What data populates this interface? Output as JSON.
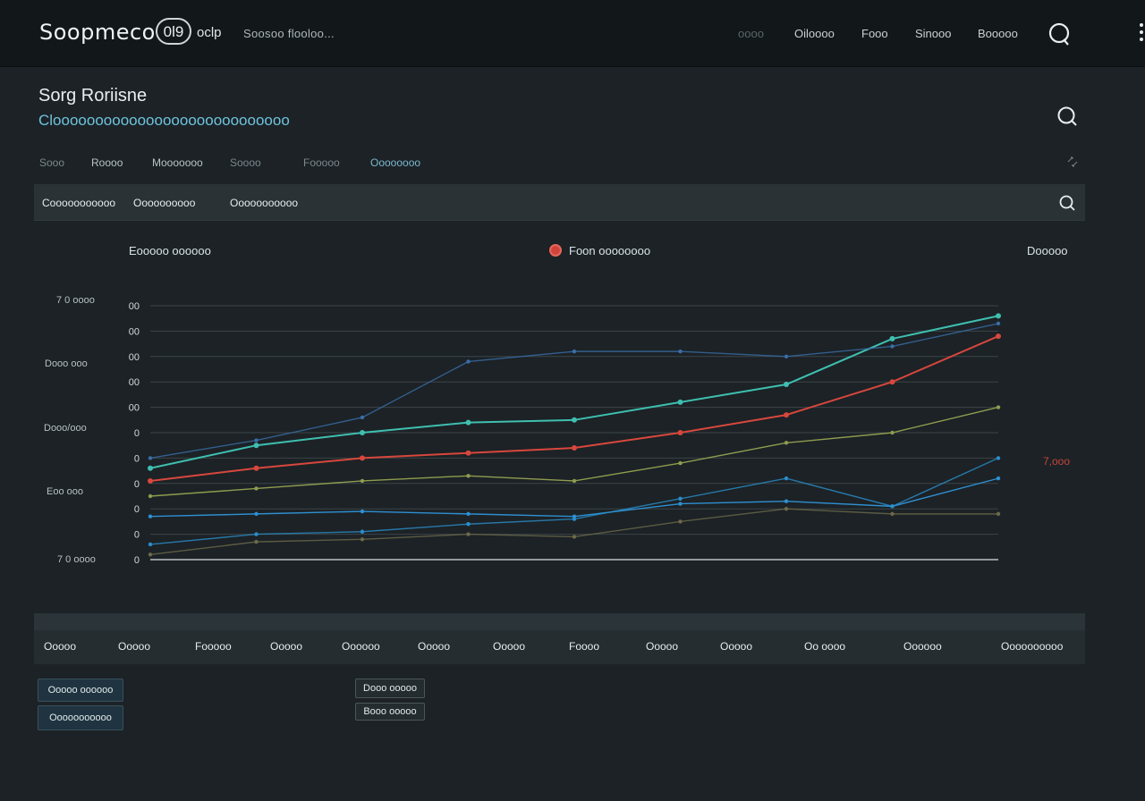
{
  "app": {
    "brand": "Soopmeco",
    "badge": "0l9",
    "badge_suffix": "oclp",
    "subtitle": "Soosoo flooloo..."
  },
  "top_nav": [
    "oooo",
    "Oiloooo",
    "Fooo",
    "Sinooo",
    "Booooo"
  ],
  "header": {
    "title": "Sorg Roriisne",
    "subtitle": "Cloooooooooooooooooooooooooooo"
  },
  "tabs": [
    "Sooo",
    "Roooo",
    "Mooooooo",
    "Soooo",
    "Fooooo",
    "Oooooooo"
  ],
  "filters": [
    "Cooooooooooo",
    "Oooooooooo",
    "Ooooooooooo"
  ],
  "chart_header": {
    "left": "Eooooo oooooo",
    "legend": "Foon oooooooo",
    "right": "Dooooo"
  },
  "outer_labels": [
    "7 0 oooo",
    "Dooo ooo",
    "Dooo/ooo",
    "Eoo ooo",
    "7 0 oooo",
    "7,ooo"
  ],
  "columns": [
    "Ooooo",
    "Ooooo",
    "Fooooo",
    "Ooooo",
    "Oooooo",
    "Ooooo",
    "Ooooo",
    "Foooo",
    "Ooooo",
    "Ooooo",
    "Oo oooo",
    "Oooooo",
    "Oooooooooo"
  ],
  "buttons": {
    "left": [
      "Ooooo oooooo",
      "Ooooooooooo"
    ],
    "middle": [
      "Dooo ooooo",
      "Booo ooooo"
    ]
  },
  "chart_data": {
    "type": "line",
    "ytick_labels": [
      "00",
      "00",
      "00",
      "00",
      "00",
      "0",
      "0",
      "0",
      "0",
      "0",
      "0"
    ],
    "x": [
      0,
      1,
      2,
      3,
      4,
      5,
      6,
      7,
      8
    ],
    "ylim": [
      0,
      100
    ],
    "series": [
      {
        "color": "#3fbfb0",
        "values": [
          36,
          45,
          50,
          54,
          55,
          62,
          69,
          87,
          96
        ]
      },
      {
        "color": "#d8473d",
        "values": [
          31,
          36,
          40,
          42,
          44,
          50,
          57,
          70,
          88
        ]
      },
      {
        "color": "#8f9c4e",
        "values": [
          25,
          28,
          31,
          33,
          31,
          38,
          46,
          50,
          60
        ]
      },
      {
        "color": "#2f8fd1",
        "values": [
          17,
          18,
          19,
          18,
          17,
          22,
          23,
          21,
          32
        ]
      },
      {
        "color": "#3a6ea8",
        "values": [
          40,
          47,
          56,
          78,
          82,
          82,
          80,
          84,
          93
        ]
      },
      {
        "color": "#2a8fcb",
        "values": [
          6,
          10,
          11,
          14,
          16,
          24,
          32,
          21,
          40
        ]
      },
      {
        "color": "#6d6a4a",
        "values": [
          2,
          7,
          8,
          10,
          9,
          15,
          20,
          18,
          18
        ]
      }
    ]
  }
}
